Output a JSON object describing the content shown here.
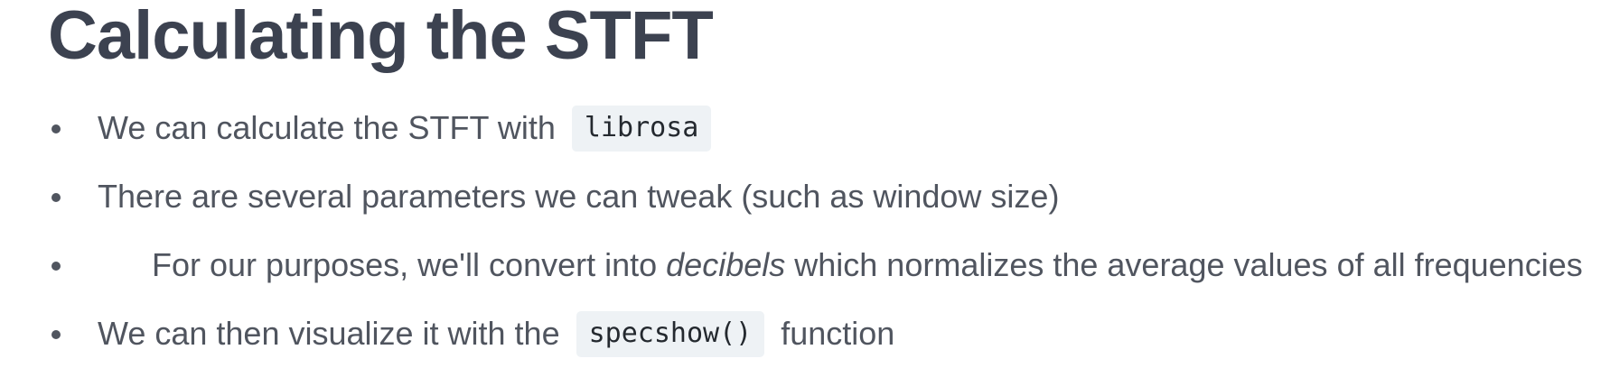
{
  "slide": {
    "title": "Calculating the STFT",
    "bullets": [
      {
        "pre": "We can calculate the STFT with",
        "code": "librosa"
      },
      {
        "text": "There are several parameters we can tweak (such as window size)"
      },
      {
        "pre": "For our purposes, we'll convert into ",
        "em": "decibels",
        "post": " which normalizes the average values of all frequencies"
      },
      {
        "pre": "We can then visualize it with the",
        "code": "specshow()",
        "post": "function"
      }
    ]
  }
}
